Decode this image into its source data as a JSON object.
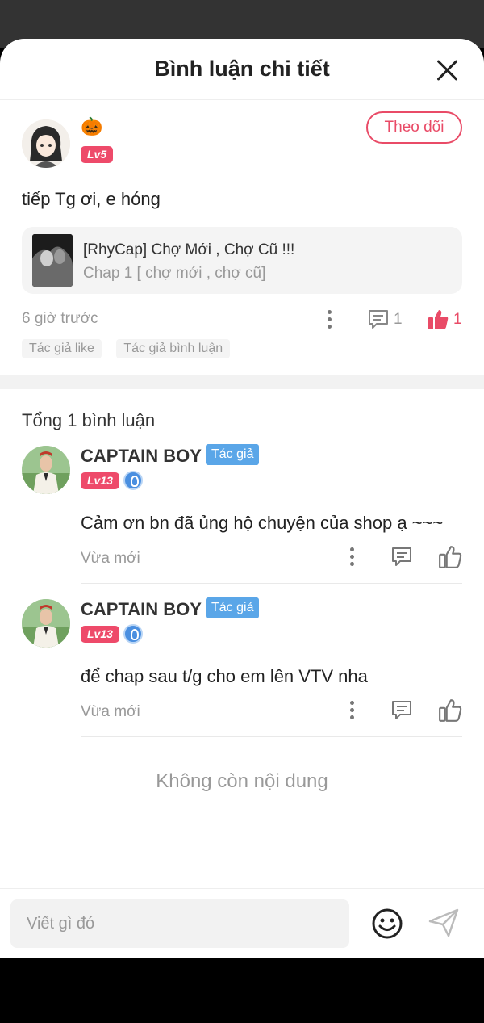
{
  "header": {
    "title": "Bình luận chi tiết"
  },
  "main_comment": {
    "user_emoji": "🎃",
    "user_level": "Lv5",
    "follow_label": "Theo dõi",
    "text": "tiếp Tg ơi, e hóng",
    "story": {
      "title": "[RhyCap] Chợ Mới , Chợ Cũ !!!",
      "chapter": "Chap 1 [ chợ mới , chợ cũ]"
    },
    "time": "6 giờ trước",
    "reply_count": "1",
    "like_count": "1",
    "tags": [
      "Tác giả like",
      "Tác giả bình luận"
    ]
  },
  "replies_section": {
    "total": "Tổng 1 bình luận",
    "replies": [
      {
        "name": "CAPTAIN BOY",
        "badge": "Tác giả",
        "level": "Lv13",
        "text": "Cảm ơn bn đã ủng hộ chuyện của shop ạ ~~~",
        "time": "Vừa mới"
      },
      {
        "name": "CAPTAIN BOY",
        "badge": "Tác giả",
        "level": "Lv13",
        "text": "để chap sau t/g cho em lên VTV nha",
        "time": "Vừa mới"
      }
    ],
    "end_text": "Không còn nội dung"
  },
  "composer": {
    "placeholder": "Viết gì đó"
  },
  "colors": {
    "accent": "#e94b67",
    "author_badge": "#5aa6e8",
    "muted_text": "#999999"
  }
}
